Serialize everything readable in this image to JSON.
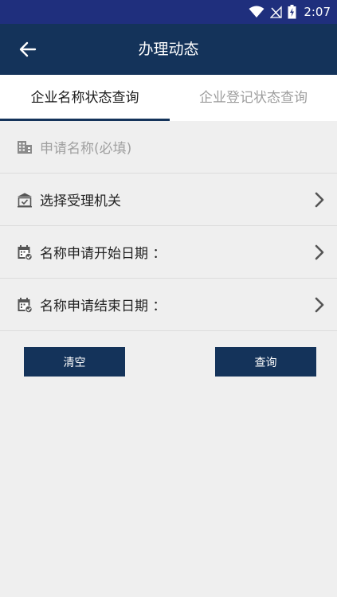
{
  "status_bar": {
    "time": "2:07",
    "icons": [
      "wifi-icon",
      "no-signal-icon",
      "battery-charging-icon"
    ]
  },
  "header": {
    "title": "办理动态",
    "back_icon": "arrow-left-icon"
  },
  "tabs": [
    {
      "label": "企业名称状态查询",
      "active": true
    },
    {
      "label": "企业登记状态查询",
      "active": false
    }
  ],
  "form": {
    "name_field": {
      "placeholder": "申请名称(必填)",
      "icon": "building-icon"
    },
    "agency": {
      "label": "选择受理机关",
      "icon": "institution-icon"
    },
    "start_date": {
      "label": "名称申请开始日期 ：",
      "icon": "calendar-check-icon"
    },
    "end_date": {
      "label": "名称申请结束日期 ：",
      "icon": "calendar-check-icon"
    }
  },
  "buttons": {
    "clear": "清空",
    "query": "查询"
  },
  "colors": {
    "status_bar": "#1f2f7d",
    "app_bar": "#14335a",
    "background": "#efefef",
    "button": "#14335a"
  }
}
